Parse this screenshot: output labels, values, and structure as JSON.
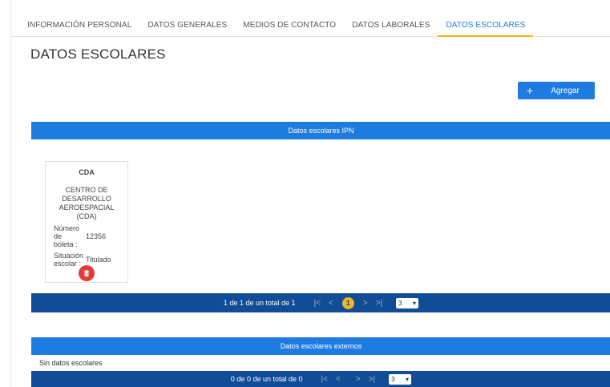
{
  "tabs": [
    {
      "label": "INFORMACIÓN PERSONAL"
    },
    {
      "label": "DATOS GENERALES"
    },
    {
      "label": "MEDIOS DE CONTACTO"
    },
    {
      "label": "DATOS LABORALES"
    },
    {
      "label": "DATOS ESCOLARES",
      "active": true
    }
  ],
  "page_title": "DATOS ESCOLARES",
  "add_button": {
    "icon": "plus-icon",
    "label": "Agregar"
  },
  "ipn_section": {
    "title": "Datos escolares IPN",
    "cards": [
      {
        "abbr": "CDA",
        "full_name": "CENTRO DE DESARROLLO AEROESPACIAL (CDA)",
        "boleta_label": "Número de boleta :",
        "boleta_value": "12356",
        "situacion_label": "Situación escolar :",
        "situacion_value": "Titulado",
        "delete_icon": "trash-icon"
      }
    ],
    "pager": {
      "summary": "1 de 1 de un total de 1",
      "first": "|<",
      "prev": "<",
      "page": "1",
      "next": ">",
      "last": ">|",
      "page_size": "3"
    }
  },
  "external_section": {
    "title": "Datos escolares externos",
    "empty_text": "Sin datos escolares",
    "pager": {
      "summary": "0 de 0 de un total de 0",
      "first": "|<",
      "prev": "<",
      "next": ">",
      "last": ">|",
      "page_size": "3"
    }
  },
  "colors": {
    "primary": "#1e7be0",
    "pager": "#114c96",
    "accent": "#f2b51d",
    "danger": "#e43a3a"
  }
}
